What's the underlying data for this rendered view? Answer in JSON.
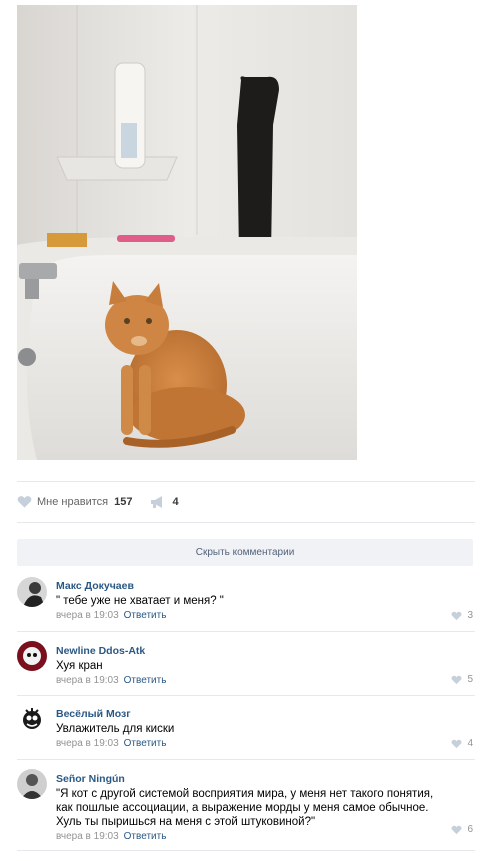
{
  "post": {
    "image_description": "Orange cat sitting in a bathtub",
    "likes": {
      "label": "Мне нравится",
      "count": "157"
    },
    "shares": {
      "count": "4"
    }
  },
  "comments_toggle": {
    "label": "Скрыть комментарии"
  },
  "comments": [
    {
      "author": "Макс Докучаев",
      "text": "\" тебе уже не хватает и меня? \"",
      "time": "вчера в 19:03",
      "reply": "Ответить",
      "likes": "3"
    },
    {
      "author": "Newline Ddos-Atk",
      "text": "Хуя кран",
      "time": "вчера в 19:03",
      "reply": "Ответить",
      "likes": "5"
    },
    {
      "author": "Весёлый Мозг",
      "text": "Увлажитель для киски",
      "time": "вчера в 19:03",
      "reply": "Ответить",
      "likes": "4"
    },
    {
      "author": "Señor Ningún",
      "text": "\"Я кот с другой системой восприятия мира, у меня нет такого понятия, как пошлые ассоциации, а выражение морды у меня самое обычное. Хуль ты пыришься на меня с этой штуковиной?\"",
      "time": "вчера в 19:03",
      "reply": "Ответить",
      "likes": "6"
    }
  ],
  "colors": {
    "link": "#2a5885",
    "meta": "#939393",
    "divider": "#e7e8ec",
    "toggle_bg": "#f0f2f5"
  }
}
